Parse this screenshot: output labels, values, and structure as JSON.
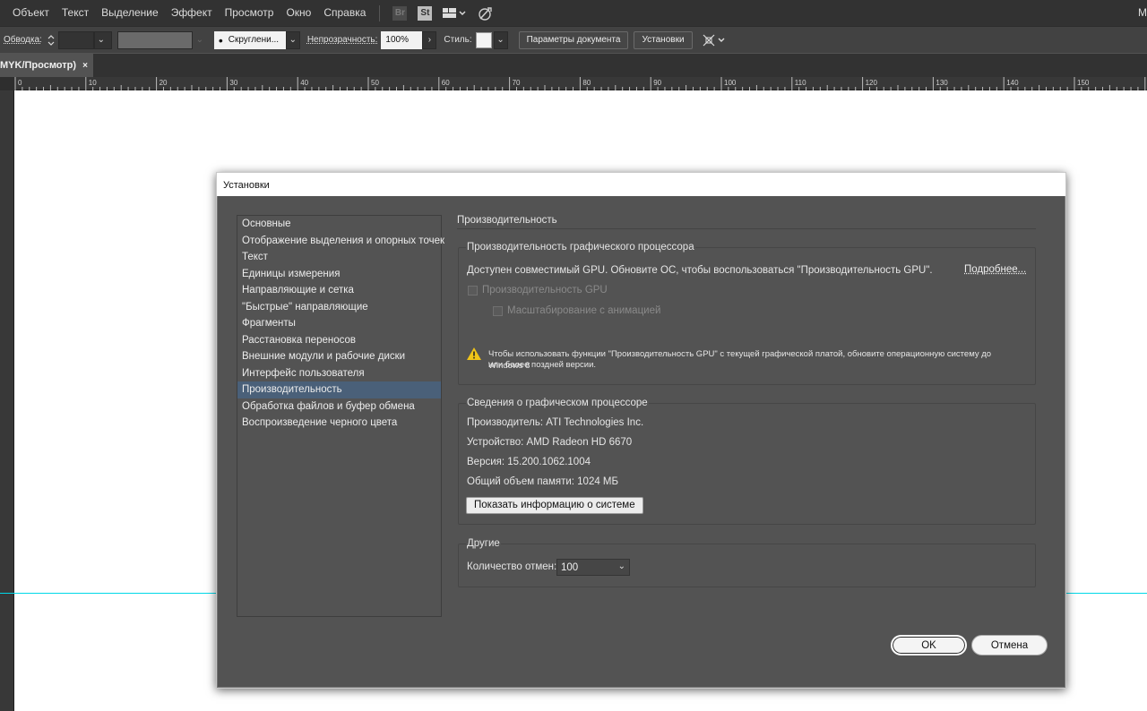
{
  "menu": {
    "items": [
      "Объект",
      "Текст",
      "Выделение",
      "Эффект",
      "Просмотр",
      "Окно",
      "Справка"
    ],
    "br_icon": "Br",
    "st_icon": "St",
    "right_text": "M"
  },
  "control_bar": {
    "stroke_label": "Обводка:",
    "brush_label": "Скруглени...",
    "opacity_label": "Непрозрачность:",
    "opacity_value": "100%",
    "style_label": "Стиль:",
    "doc_params_button": "Параметры документа",
    "prefs_button": "Установки"
  },
  "tab": {
    "title": "MYK/Просмотр)",
    "close": "×"
  },
  "ruler": {
    "labels": [
      "0",
      "10",
      "20",
      "30",
      "40",
      "50",
      "60",
      "70",
      "80",
      "90",
      "100",
      "110",
      "120",
      "130",
      "140",
      "150"
    ]
  },
  "dialog": {
    "title": "Установки",
    "sidebar": [
      "Основные",
      "Отображение выделения и опорных точек",
      "Текст",
      "Единицы измерения",
      "Направляющие и сетка",
      "\"Быстрые\" направляющие",
      "Фрагменты",
      "Расстановка переносов",
      "Внешние модули и рабочие диски",
      "Интерфейс пользователя",
      "Производительность",
      "Обработка файлов и буфер обмена",
      "Воспроизведение черного цвета"
    ],
    "selected_index": 10,
    "panel_title": "Производительность",
    "gpu_group": {
      "title": "Производительность графического процессора",
      "notice": "Доступен совместимый GPU. Обновите ОС, чтобы воспользоваться \"Производительность GPU\".",
      "more_link": "Подробнее...",
      "gpu_checkbox": "Производительность GPU",
      "anim_checkbox": "Масштабирование с анимацией",
      "warning_line1": "Чтобы использовать функции \"Производительность GPU\" с текущей графической платой, обновите операционную систему до Windows 8",
      "warning_line2": "или более поздней версии."
    },
    "info_group": {
      "title": "Сведения о графическом процессоре",
      "vendor": "Производитель: ATI Technologies Inc.",
      "device": "Устройство: AMD Radeon HD 6670",
      "version": "Версия: 15.200.1062.1004",
      "memory": "Общий объем памяти: 1024 МБ",
      "system_info_button": "Показать информацию о системе"
    },
    "other_group": {
      "title": "Другие",
      "undo_label": "Количество отмен:",
      "undo_value": "100"
    },
    "ok_button": "OK",
    "cancel_button": "Отмена"
  },
  "colors": {
    "selected_item": "#4a6079",
    "guide": "#00d8e8",
    "dialog_bg": "#535353"
  }
}
